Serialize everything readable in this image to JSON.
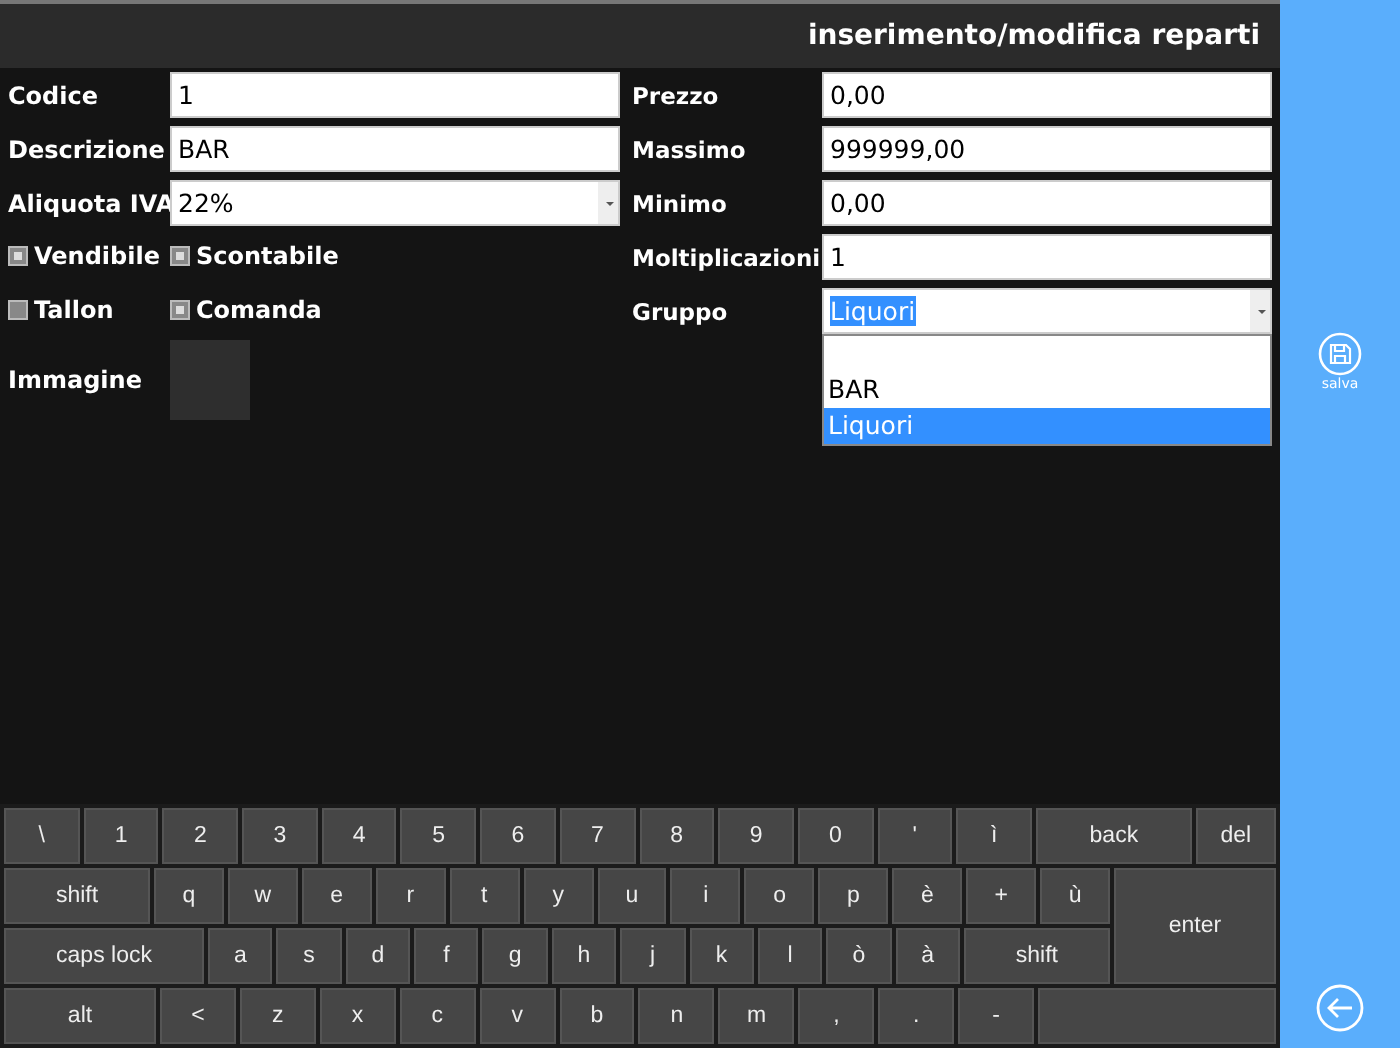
{
  "title": "inserimento/modifica reparti",
  "left_fields": [
    {
      "label": "Codice",
      "value": "1",
      "kind": "text"
    },
    {
      "label": "Descrizione",
      "value": "BAR",
      "kind": "text"
    },
    {
      "label": "Aliquota IVA",
      "value": "22%",
      "kind": "select"
    }
  ],
  "checkboxes": [
    {
      "label": "Vendibile",
      "checked": true
    },
    {
      "label": "Scontabile",
      "checked": true
    },
    {
      "label": "Tallon",
      "checked": false
    },
    {
      "label": "Comanda",
      "checked": true
    }
  ],
  "image_field": {
    "label": "Immagine"
  },
  "right_fields": [
    {
      "label": "Prezzo",
      "value": "0,00",
      "kind": "text"
    },
    {
      "label": "Massimo",
      "value": "999999,00",
      "kind": "text"
    },
    {
      "label": "Minimo",
      "value": "0,00",
      "kind": "text"
    },
    {
      "label": "Moltiplicazioni",
      "value": "1",
      "kind": "text"
    },
    {
      "label": "Gruppo",
      "value": "Liquori",
      "kind": "select",
      "open": true,
      "options": [
        {
          "label": "BAR",
          "selected": false
        },
        {
          "label": "Liquori",
          "selected": true
        }
      ]
    }
  ],
  "keyboard": [
    [
      {
        "label": "\\",
        "kind": "char"
      },
      {
        "label": "1",
        "kind": "char"
      },
      {
        "label": "2",
        "kind": "char"
      },
      {
        "label": "3",
        "kind": "char"
      },
      {
        "label": "4",
        "kind": "char"
      },
      {
        "label": "5",
        "kind": "char"
      },
      {
        "label": "6",
        "kind": "char"
      },
      {
        "label": "7",
        "kind": "char"
      },
      {
        "label": "8",
        "kind": "char"
      },
      {
        "label": "9",
        "kind": "char"
      },
      {
        "label": "0",
        "kind": "char"
      },
      {
        "label": "'",
        "kind": "char"
      },
      {
        "label": "ì",
        "kind": "char"
      },
      {
        "label": "back",
        "kind": "back"
      },
      {
        "label": "del",
        "kind": "del"
      }
    ],
    [
      {
        "label": "shift",
        "kind": "shift"
      },
      {
        "label": "q",
        "kind": "char"
      },
      {
        "label": "w",
        "kind": "char"
      },
      {
        "label": "e",
        "kind": "char"
      },
      {
        "label": "r",
        "kind": "char"
      },
      {
        "label": "t",
        "kind": "char"
      },
      {
        "label": "y",
        "kind": "char"
      },
      {
        "label": "u",
        "kind": "char"
      },
      {
        "label": "i",
        "kind": "char"
      },
      {
        "label": "o",
        "kind": "char"
      },
      {
        "label": "p",
        "kind": "char"
      },
      {
        "label": "è",
        "kind": "char"
      },
      {
        "label": "+",
        "kind": "char"
      },
      {
        "label": "ù",
        "kind": "char"
      },
      {
        "label": "enter",
        "kind": "enter"
      }
    ],
    [
      {
        "label": "caps lock",
        "kind": "caps"
      },
      {
        "label": "a",
        "kind": "char"
      },
      {
        "label": "s",
        "kind": "char"
      },
      {
        "label": "d",
        "kind": "char"
      },
      {
        "label": "f",
        "kind": "char"
      },
      {
        "label": "g",
        "kind": "char"
      },
      {
        "label": "h",
        "kind": "char"
      },
      {
        "label": "j",
        "kind": "char"
      },
      {
        "label": "k",
        "kind": "char"
      },
      {
        "label": "l",
        "kind": "char"
      },
      {
        "label": "ò",
        "kind": "char"
      },
      {
        "label": "à",
        "kind": "char"
      },
      {
        "label": "shift",
        "kind": "shift"
      }
    ],
    [
      {
        "label": "alt",
        "kind": "alt"
      },
      {
        "label": "<",
        "kind": "char"
      },
      {
        "label": "z",
        "kind": "char"
      },
      {
        "label": "x",
        "kind": "char"
      },
      {
        "label": "c",
        "kind": "char"
      },
      {
        "label": "v",
        "kind": "char"
      },
      {
        "label": "b",
        "kind": "char"
      },
      {
        "label": "n",
        "kind": "char"
      },
      {
        "label": "m",
        "kind": "char"
      },
      {
        "label": ",",
        "kind": "char"
      },
      {
        "label": ".",
        "kind": "char"
      },
      {
        "label": "-",
        "kind": "char"
      },
      {
        "kind": "space"
      }
    ]
  ],
  "sidebar": {
    "save_label": "salva"
  }
}
